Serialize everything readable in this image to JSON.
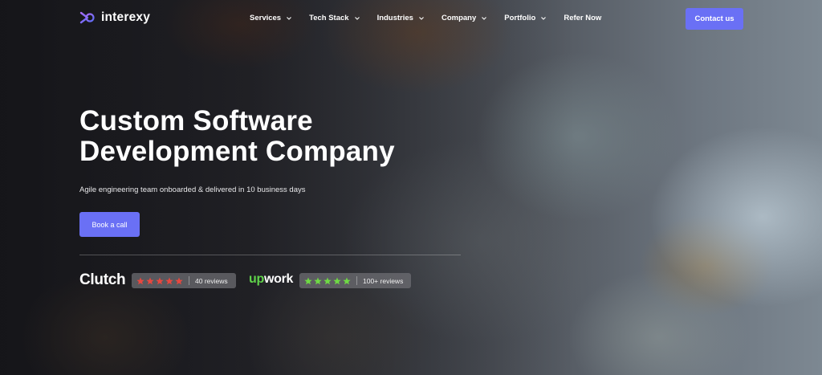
{
  "brand": {
    "name": "interexy"
  },
  "nav": {
    "items": [
      {
        "label": "Services",
        "dropdown": true
      },
      {
        "label": "Tech Stack",
        "dropdown": true
      },
      {
        "label": "Industries",
        "dropdown": true
      },
      {
        "label": "Company",
        "dropdown": true
      },
      {
        "label": "Portfolio",
        "dropdown": true
      },
      {
        "label": "Refer Now",
        "dropdown": false
      }
    ],
    "contact_label": "Contact us"
  },
  "hero": {
    "title_line1": "Custom Software",
    "title_line2": "Development Company",
    "subtitle": "Agile engineering team onboarded & delivered in 10 business days",
    "cta_label": "Book a call"
  },
  "ratings": {
    "clutch": {
      "logo_text": "Clutch",
      "stars": 5,
      "reviews": "40 reviews",
      "star_color": "#e8473f"
    },
    "upwork": {
      "logo_up": "up",
      "logo_rest": "work",
      "stars": 5,
      "reviews": "100+ reviews",
      "star_color": "#6fda44"
    }
  },
  "colors": {
    "accent": "#6a70f5"
  }
}
